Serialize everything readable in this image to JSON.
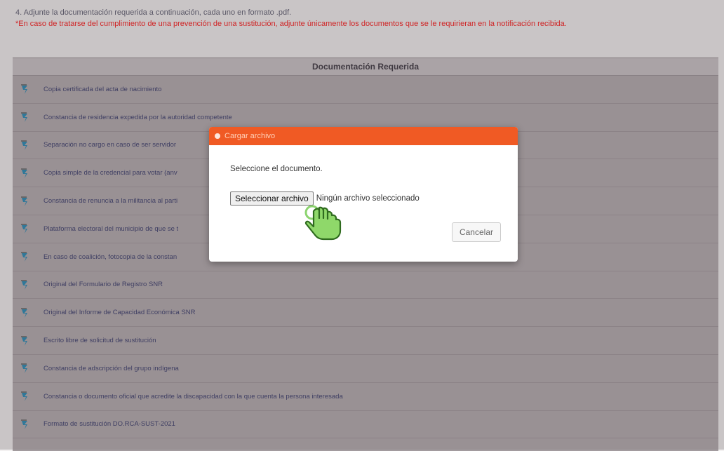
{
  "instructions": {
    "line1": "4. Adjunte la documentación requerida a continuación, cada uno en formato .pdf.",
    "warning": "*En caso de tratarse del cumplimiento de una prevención de una sustitución, adjunte únicamente los documentos que se le requirieran en la notificación recibida."
  },
  "table": {
    "header": "Documentación Requerida",
    "rows": [
      {
        "label": "Copia certificada del acta de nacimiento"
      },
      {
        "label": "Constancia de residencia expedida por la autoridad competente"
      },
      {
        "label": "Separación no cargo en caso de ser servidor"
      },
      {
        "label": "Copia simple de la credencial para votar (anv"
      },
      {
        "label": "Constancia de renuncia a la militancia al parti"
      },
      {
        "label": "Plataforma electoral del municipio de que se t"
      },
      {
        "label": "En caso de coalición, fotocopia de la constan"
      },
      {
        "label": "Original del Formulario de Registro SNR"
      },
      {
        "label": "Original del Informe de Capacidad Económica SNR"
      },
      {
        "label": "Escrito libre de solicitud de sustitución"
      },
      {
        "label": "Constancia de adscripción del grupo indígena"
      },
      {
        "label": "Constancia o documento oficial que acredite la discapacidad con la que cuenta la persona interesada"
      },
      {
        "label": "Formato de sustitución DO.RCA-SUST-2021"
      }
    ]
  },
  "modal": {
    "title": "Cargar archivo",
    "prompt": "Seleccione el documento.",
    "file_button": "Seleccionar archivo",
    "file_status": "Ningún archivo seleccionado",
    "cancel": "Cancelar"
  },
  "colors": {
    "accent": "#f05a24",
    "warning": "#e02020",
    "link": "#3c3e66",
    "icon": "#2b7fa3"
  }
}
